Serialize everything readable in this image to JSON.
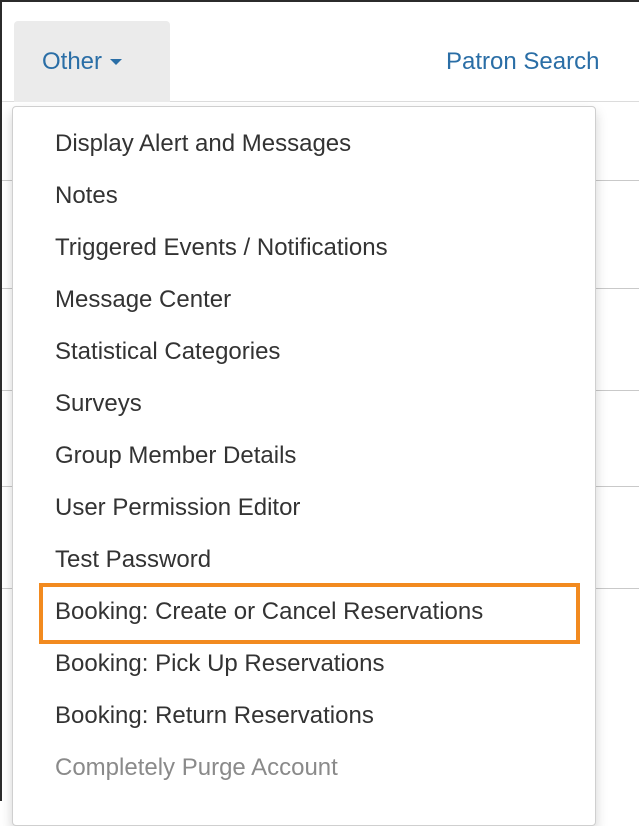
{
  "nav": {
    "other_label": "Other",
    "patron_search_label": "Patron Search"
  },
  "menu": {
    "items": [
      {
        "label": "Display Alert and Messages"
      },
      {
        "label": "Notes"
      },
      {
        "label": "Triggered Events / Notifications"
      },
      {
        "label": "Message Center"
      },
      {
        "label": "Statistical Categories"
      },
      {
        "label": "Surveys"
      },
      {
        "label": "Group Member Details"
      },
      {
        "label": "User Permission Editor"
      },
      {
        "label": "Test Password"
      },
      {
        "label": "Booking: Create or Cancel Reservations"
      },
      {
        "label": "Booking: Pick Up Reservations"
      },
      {
        "label": "Booking: Return Reservations"
      },
      {
        "label": "Completely Purge Account"
      }
    ]
  },
  "colors": {
    "link": "#2a6ea6",
    "highlight": "#f28a1f",
    "disabled": "#8a8a8a"
  },
  "icons": {
    "dropdown_caret": "caret-down-icon"
  }
}
